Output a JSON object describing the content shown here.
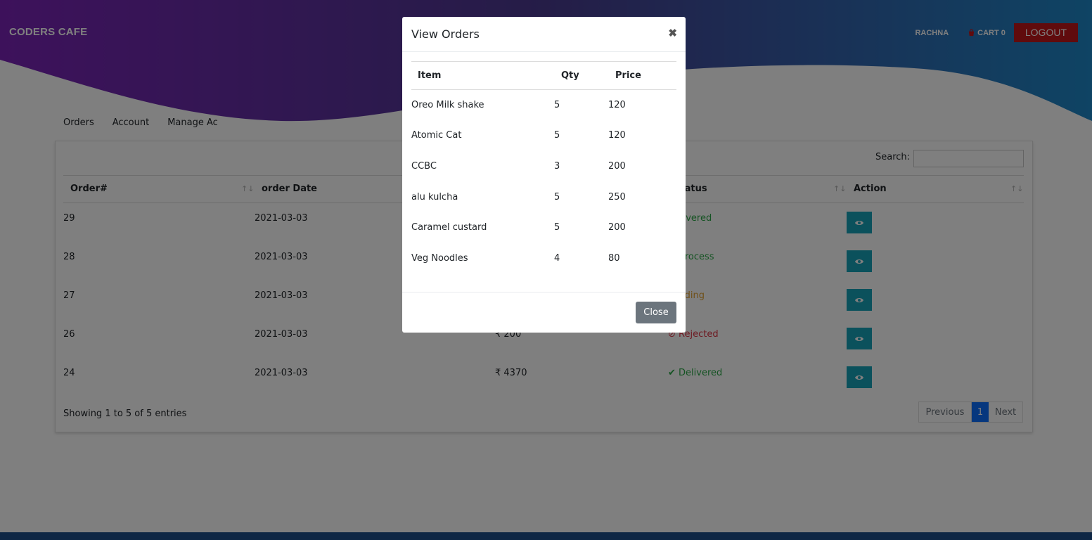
{
  "navbar": {
    "brand": "CODERS CAFE",
    "user": "RACHNA",
    "cart_label": "CART 0",
    "logout_label": "LOGOUT"
  },
  "tabs": [
    "Orders",
    "Account",
    "Manage Ac"
  ],
  "search": {
    "label": "Search:",
    "value": ""
  },
  "table": {
    "headers": {
      "order": "Order#",
      "date": "order Date",
      "status": "Status",
      "action": "Action"
    },
    "rows": [
      {
        "order": "29",
        "date": "2021-03-03",
        "amount": "",
        "status": "Delivered",
        "status_type": "delivered"
      },
      {
        "order": "28",
        "date": "2021-03-03",
        "amount": "",
        "status": "In Process",
        "status_type": "process"
      },
      {
        "order": "27",
        "date": "2021-03-03",
        "amount": "",
        "status": "Pending",
        "status_type": "pending"
      },
      {
        "order": "26",
        "date": "2021-03-03",
        "amount": "₹ 200",
        "status": "Rejected",
        "status_type": "rejected"
      },
      {
        "order": "24",
        "date": "2021-03-03",
        "amount": "₹ 4370",
        "status": "Delivered",
        "status_type": "delivered"
      }
    ]
  },
  "info": "Showing 1 to 5 of 5 entries",
  "pagination": {
    "prev": "Previous",
    "current": "1",
    "next": "Next"
  },
  "modal": {
    "title": "View Orders",
    "close_symbol": "✖",
    "headers": {
      "item": "Item",
      "qty": "Qty",
      "price": "Price"
    },
    "items": [
      {
        "item": "Oreo Milk shake",
        "qty": "5",
        "price": "120"
      },
      {
        "item": "Atomic Cat",
        "qty": "5",
        "price": "120"
      },
      {
        "item": "CCBC",
        "qty": "3",
        "price": "200"
      },
      {
        "item": "alu kulcha",
        "qty": "5",
        "price": "250"
      },
      {
        "item": "Caramel custard",
        "qty": "5",
        "price": "200"
      },
      {
        "item": "Veg Noodles",
        "qty": "4",
        "price": "80"
      }
    ],
    "close_label": "Close"
  },
  "colors": {
    "header_gradient_start": "#7b23b7",
    "header_gradient_end": "#1e88c8",
    "logout": "#c0161b",
    "action_button": "#17a2b8",
    "page_active": "#0d6efd",
    "footer": "#1f4f8a"
  }
}
